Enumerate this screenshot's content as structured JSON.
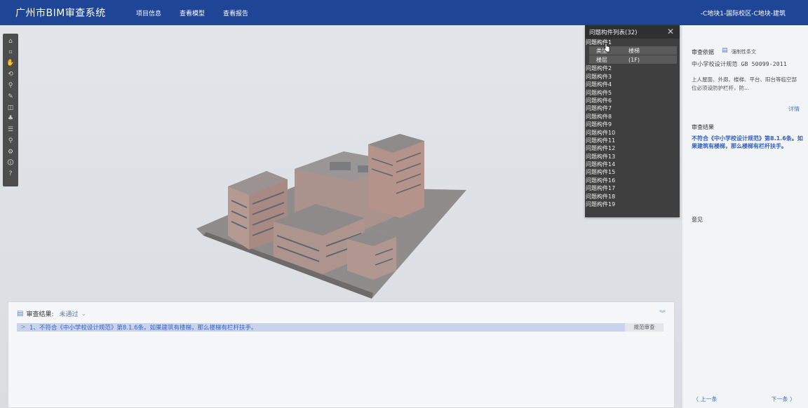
{
  "header": {
    "app_title": "广州市BIM审查系统",
    "nav": [
      "项目信息",
      "查看模型",
      "查看报告"
    ],
    "project_path": "-C地块1-国际校区-C地块-建筑"
  },
  "toolbar": {
    "icons": [
      "home-icon",
      "fit-view-icon",
      "pan-icon",
      "orbit-icon",
      "walk-icon",
      "measure-icon",
      "section-icon",
      "model-tree-icon",
      "properties-icon",
      "search-icon",
      "settings-icon",
      "info-icon",
      "help-icon"
    ],
    "glyphs": [
      "⌂",
      "⌗",
      "✋",
      "⟲",
      "⚲",
      "✎",
      "◫",
      "♣",
      "☰",
      "⚲",
      "⚙",
      "🛈",
      "?"
    ]
  },
  "issue_panel": {
    "title": "问题构件列表(32)",
    "close": "✕",
    "first_item": "问题构件1",
    "detail": [
      {
        "label": "类型",
        "value": "楼梯"
      },
      {
        "label": "楼层",
        "value": "(1F)"
      }
    ],
    "items": [
      "问题构件2",
      "问题构件3",
      "问题构件4",
      "问题构件5",
      "问题构件6",
      "问题构件7",
      "问题构件8",
      "问题构件9",
      "问题构件10",
      "问题构件11",
      "问题构件12",
      "问题构件13",
      "问题构件14",
      "问题构件15",
      "问题构件16",
      "问题构件17",
      "问题构件18",
      "问题构件19"
    ]
  },
  "right_panel": {
    "basis_label": "审查依据",
    "basis_type": "强制性条文",
    "standard": "中小学校设计规范 GB 50099-2011",
    "clause": "上人屋面、外廊、楼梯、平台、阳台等临空部位必须设防护栏杆，防...",
    "detail_link": "详情",
    "result_label": "审查结果",
    "result_text": "不符合《中小学校设计规范》第8.1.6条。如果建筑有楼梯，那么楼梯有栏杆扶手。",
    "opinion_label": "意见",
    "prev": "〈 上一条",
    "next": "下一条 〉"
  },
  "bottom_panel": {
    "label": "审查结果:",
    "status": "未通过",
    "chevron": "⌄",
    "collapse": "︾",
    "issue_text": "1、不符合《中小学校设计规范》第8.1.6条。如果建筑有楼梯，那么楼梯有栏杆扶手。",
    "expand": ">",
    "standard_button": "规范审查"
  }
}
